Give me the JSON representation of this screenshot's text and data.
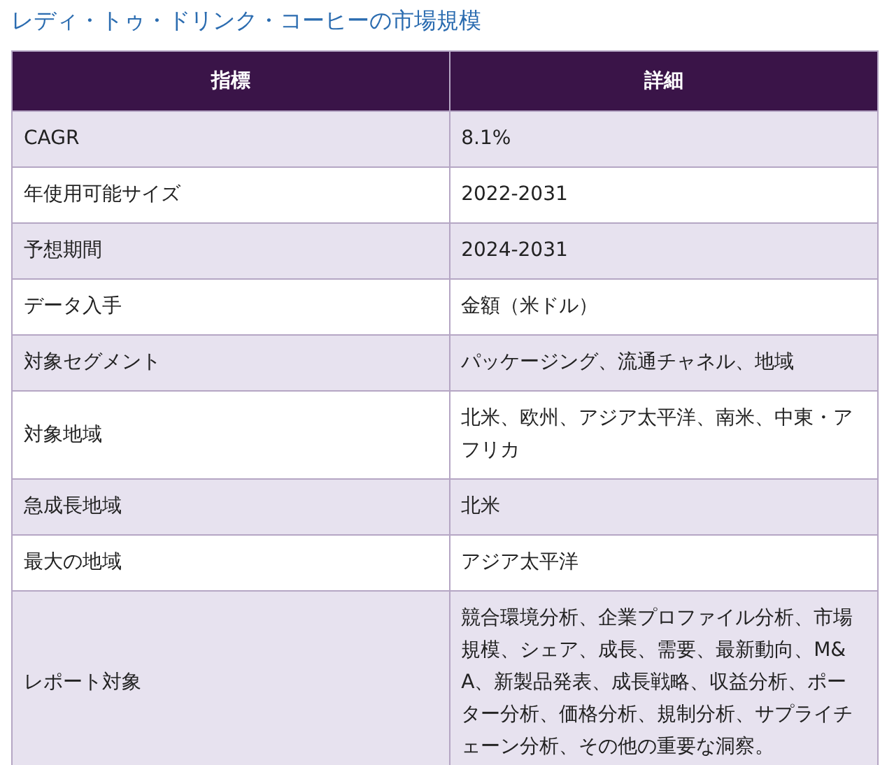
{
  "title": "レディ・トゥ・ドリンク・コーヒーの市場規模",
  "table": {
    "columns": [
      "指標",
      "詳細"
    ],
    "rows": [
      {
        "label": "CAGR",
        "detail": "8.1%"
      },
      {
        "label": "年使用可能サイズ",
        "detail": "2022-2031"
      },
      {
        "label": "予想期間",
        "detail": "2024-2031"
      },
      {
        "label": "データ入手",
        "detail": "金額（米ドル）"
      },
      {
        "label": "対象セグメント",
        "detail": "パッケージング、流通チャネル、地域"
      },
      {
        "label": "対象地域",
        "detail": "北米、欧州、アジア太平洋、南米、中東・アフリカ"
      },
      {
        "label": "急成長地域",
        "detail": "北米"
      },
      {
        "label": "最大の地域",
        "detail": "アジア太平洋"
      },
      {
        "label": "レポート対象",
        "detail": "競合環境分析、企業プロファイル分析、市場規模、シェア、成長、需要、最新動向、M&A、新製品発表、成長戦略、収益分析、ポーター分析、価格分析、規制分析、サプライチェーン分析、その他の重要な洞察。"
      }
    ]
  }
}
